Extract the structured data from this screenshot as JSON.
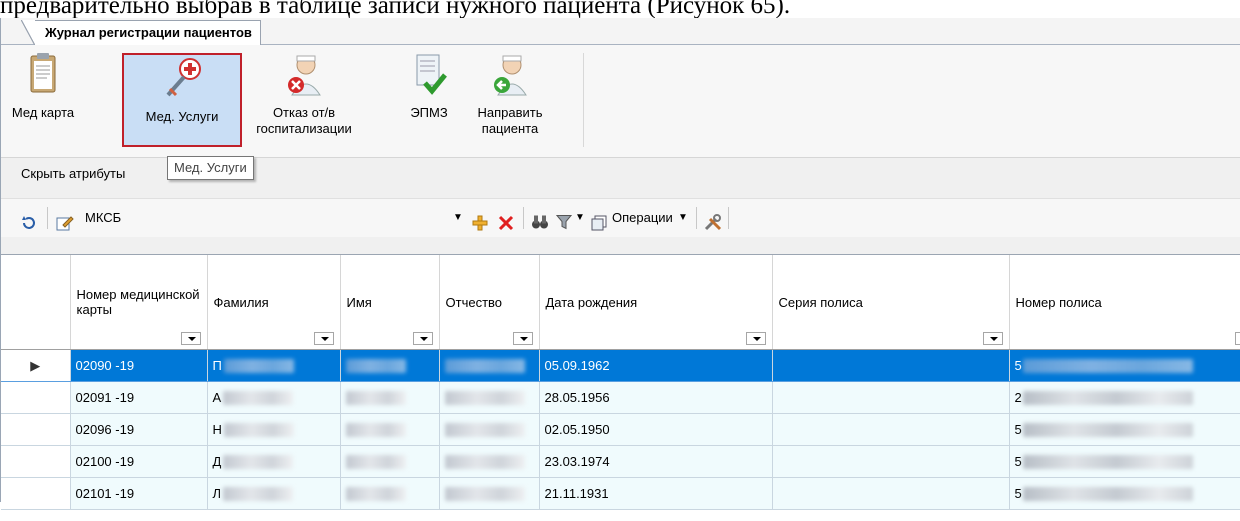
{
  "document": {
    "caption_line": "предварительно выбрав в таблице записи нужного пациента (Рисунок 65)."
  },
  "tab": {
    "label": "Журнал регистрации пациентов"
  },
  "ribbon": {
    "buttons": [
      {
        "label": "Мед карта",
        "icon": "clipboard-icon"
      },
      {
        "label": "Мед. Услуги",
        "icon": "medical-services-icon",
        "selected": true
      },
      {
        "label": "Отказ от/в госпитализации",
        "icon": "doctor-refuse-icon"
      },
      {
        "label": "ЭПМЗ",
        "icon": "document-check-icon"
      },
      {
        "label": "Направить пациента",
        "icon": "doctor-refer-icon"
      }
    ]
  },
  "attributes": {
    "toggle_label": "Скрыть атрибуты"
  },
  "tooltip": {
    "text": "Мед. Услуги"
  },
  "toolbar": {
    "filter_value": "МКСБ",
    "operations_label": "Операции"
  },
  "grid": {
    "columns": [
      "Номер медицинской карты",
      "Фамилия",
      "Имя",
      "Отчество",
      "Дата рождения",
      "Серия полиса",
      "Номер полиса"
    ],
    "rows": [
      {
        "card": "02090 -19",
        "surname_initial": "П",
        "birth": "05.09.1962",
        "policy_series": "",
        "policy_prefix": "5"
      },
      {
        "card": "02091 -19",
        "surname_initial": "А",
        "birth": "28.05.1956",
        "policy_series": "",
        "policy_prefix": "2"
      },
      {
        "card": "02096 -19",
        "surname_initial": "Н",
        "birth": "02.05.1950",
        "policy_series": "",
        "policy_prefix": "5"
      },
      {
        "card": "02100 -19",
        "surname_initial": "Д",
        "birth": "23.03.1974",
        "policy_series": "",
        "policy_prefix": "5"
      },
      {
        "card": "02101 -19",
        "surname_initial": "Л",
        "birth": "21.11.1931",
        "policy_series": "",
        "policy_prefix": "5"
      }
    ],
    "selected_row": 0
  },
  "colors": {
    "selection": "#0078d7",
    "row_bg": "#f0fbfd",
    "highlight_border": "#c0202a"
  }
}
